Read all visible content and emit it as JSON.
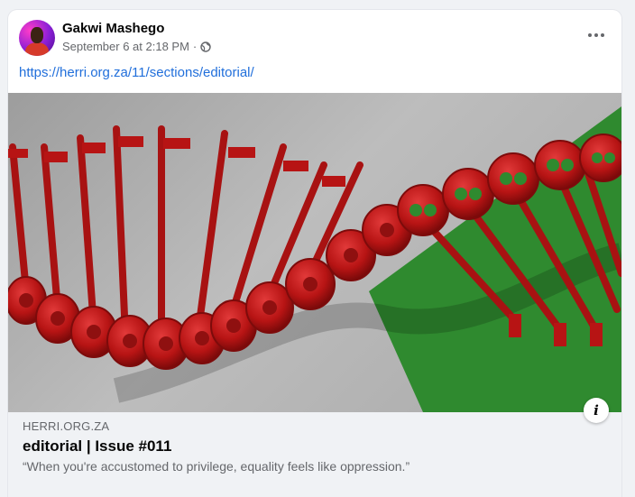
{
  "post": {
    "author": "Gakwi Mashego",
    "timestamp": "September 6 at 2:18 PM",
    "separator": "·",
    "privacy_icon": "globe-icon",
    "more_icon": "more-options-icon",
    "link_text": "https://herri.org.za/11/sections/editorial/"
  },
  "image": {
    "description_icon": "info-icon",
    "info_label": "i",
    "colors": {
      "background": "#b3b3b3",
      "accent": "#2f8a2f",
      "keys": "#c01818"
    }
  },
  "preview": {
    "domain": "HERRI.ORG.ZA",
    "title": "editorial | Issue #011",
    "description": "“When you're accustomed to privilege, equality feels like oppression.”"
  }
}
